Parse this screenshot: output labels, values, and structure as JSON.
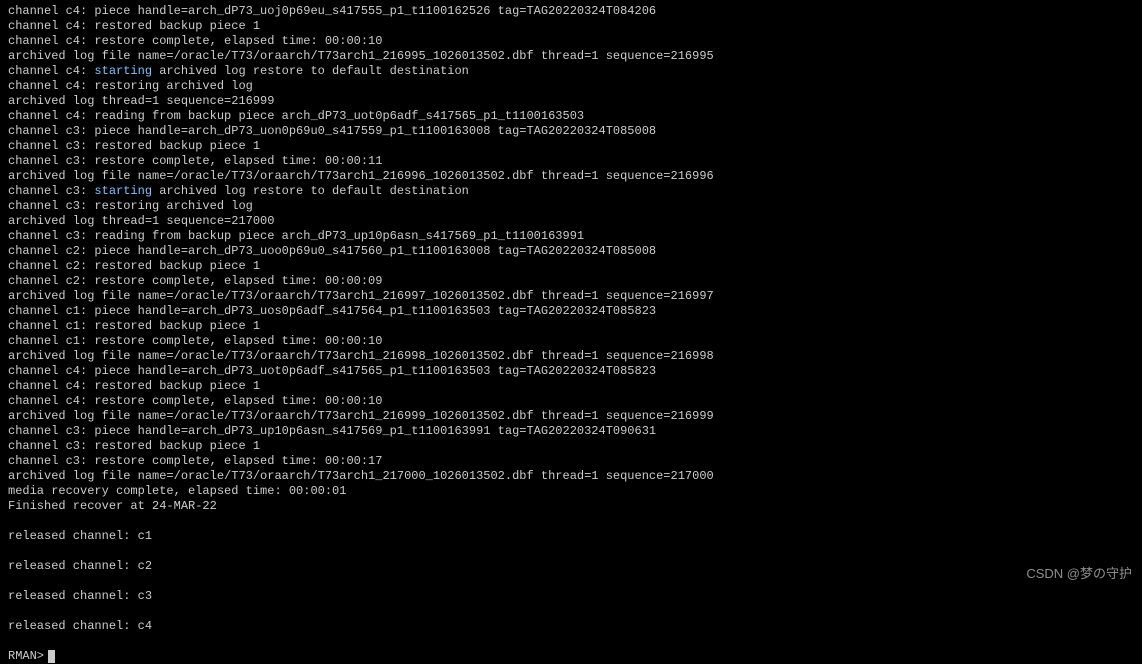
{
  "lines": [
    {
      "segs": [
        {
          "t": "channel c4: piece handle=arch_dP73_uoj0p69eu_s417555_p1_t1100162526 tag=TAG20220324T084206"
        }
      ]
    },
    {
      "segs": [
        {
          "t": "channel c4: restored backup piece 1"
        }
      ]
    },
    {
      "segs": [
        {
          "t": "channel c4: restore complete, elapsed time: 00:00:10"
        }
      ]
    },
    {
      "segs": [
        {
          "t": "archived log file name=/oracle/T73/oraarch/T73arch1_216995_1026013502.dbf thread=1 sequence=216995"
        }
      ]
    },
    {
      "segs": [
        {
          "t": "channel c4: "
        },
        {
          "t": "starting",
          "hl": true
        },
        {
          "t": " archived log restore to default destination"
        }
      ]
    },
    {
      "segs": [
        {
          "t": "channel c4: restoring archived log"
        }
      ]
    },
    {
      "segs": [
        {
          "t": "archived log thread=1 sequence=216999"
        }
      ]
    },
    {
      "segs": [
        {
          "t": "channel c4: reading from backup piece arch_dP73_uot0p6adf_s417565_p1_t1100163503"
        }
      ]
    },
    {
      "segs": [
        {
          "t": "channel c3: piece handle=arch_dP73_uon0p69u0_s417559_p1_t1100163008 tag=TAG20220324T085008"
        }
      ]
    },
    {
      "segs": [
        {
          "t": "channel c3: restored backup piece 1"
        }
      ]
    },
    {
      "segs": [
        {
          "t": "channel c3: restore complete, elapsed time: 00:00:11"
        }
      ]
    },
    {
      "segs": [
        {
          "t": "archived log file name=/oracle/T73/oraarch/T73arch1_216996_1026013502.dbf thread=1 sequence=216996"
        }
      ]
    },
    {
      "segs": [
        {
          "t": "channel c3: "
        },
        {
          "t": "starting",
          "hl": true
        },
        {
          "t": " archived log restore to default destination"
        }
      ]
    },
    {
      "segs": [
        {
          "t": "channel c3: restoring archived log"
        }
      ]
    },
    {
      "segs": [
        {
          "t": "archived log thread=1 sequence=217000"
        }
      ]
    },
    {
      "segs": [
        {
          "t": "channel c3: reading from backup piece arch_dP73_up10p6asn_s417569_p1_t1100163991"
        }
      ]
    },
    {
      "segs": [
        {
          "t": "channel c2: piece handle=arch_dP73_uoo0p69u0_s417560_p1_t1100163008 tag=TAG20220324T085008"
        }
      ]
    },
    {
      "segs": [
        {
          "t": "channel c2: restored backup piece 1"
        }
      ]
    },
    {
      "segs": [
        {
          "t": "channel c2: restore complete, elapsed time: 00:00:09"
        }
      ]
    },
    {
      "segs": [
        {
          "t": "archived log file name=/oracle/T73/oraarch/T73arch1_216997_1026013502.dbf thread=1 sequence=216997"
        }
      ]
    },
    {
      "segs": [
        {
          "t": "channel c1: piece handle=arch_dP73_uos0p6adf_s417564_p1_t1100163503 tag=TAG20220324T085823"
        }
      ]
    },
    {
      "segs": [
        {
          "t": "channel c1: restored backup piece 1"
        }
      ]
    },
    {
      "segs": [
        {
          "t": "channel c1: restore complete, elapsed time: 00:00:10"
        }
      ]
    },
    {
      "segs": [
        {
          "t": "archived log file name=/oracle/T73/oraarch/T73arch1_216998_1026013502.dbf thread=1 sequence=216998"
        }
      ]
    },
    {
      "segs": [
        {
          "t": "channel c4: piece handle=arch_dP73_uot0p6adf_s417565_p1_t1100163503 tag=TAG20220324T085823"
        }
      ]
    },
    {
      "segs": [
        {
          "t": "channel c4: restored backup piece 1"
        }
      ]
    },
    {
      "segs": [
        {
          "t": "channel c4: restore complete, elapsed time: 00:00:10"
        }
      ]
    },
    {
      "segs": [
        {
          "t": "archived log file name=/oracle/T73/oraarch/T73arch1_216999_1026013502.dbf thread=1 sequence=216999"
        }
      ]
    },
    {
      "segs": [
        {
          "t": "channel c3: piece handle=arch_dP73_up10p6asn_s417569_p1_t1100163991 tag=TAG20220324T090631"
        }
      ]
    },
    {
      "segs": [
        {
          "t": "channel c3: restored backup piece 1"
        }
      ]
    },
    {
      "segs": [
        {
          "t": "channel c3: restore complete, elapsed time: 00:00:17"
        }
      ]
    },
    {
      "segs": [
        {
          "t": "archived log file name=/oracle/T73/oraarch/T73arch1_217000_1026013502.dbf thread=1 sequence=217000"
        }
      ]
    },
    {
      "segs": [
        {
          "t": "media recovery complete, elapsed time: 00:00:01"
        }
      ]
    },
    {
      "segs": [
        {
          "t": "Finished recover at 24-MAR-22"
        }
      ]
    },
    {
      "segs": [
        {
          "t": " "
        }
      ]
    },
    {
      "segs": [
        {
          "t": "released channel: c1"
        }
      ]
    },
    {
      "segs": [
        {
          "t": " "
        }
      ]
    },
    {
      "segs": [
        {
          "t": "released channel: c2"
        }
      ]
    },
    {
      "segs": [
        {
          "t": " "
        }
      ]
    },
    {
      "segs": [
        {
          "t": "released channel: c3"
        }
      ]
    },
    {
      "segs": [
        {
          "t": " "
        }
      ]
    },
    {
      "segs": [
        {
          "t": "released channel: c4"
        }
      ]
    },
    {
      "segs": [
        {
          "t": " "
        }
      ]
    }
  ],
  "prompt": "RMAN> ",
  "watermark": "CSDN @梦の守护"
}
